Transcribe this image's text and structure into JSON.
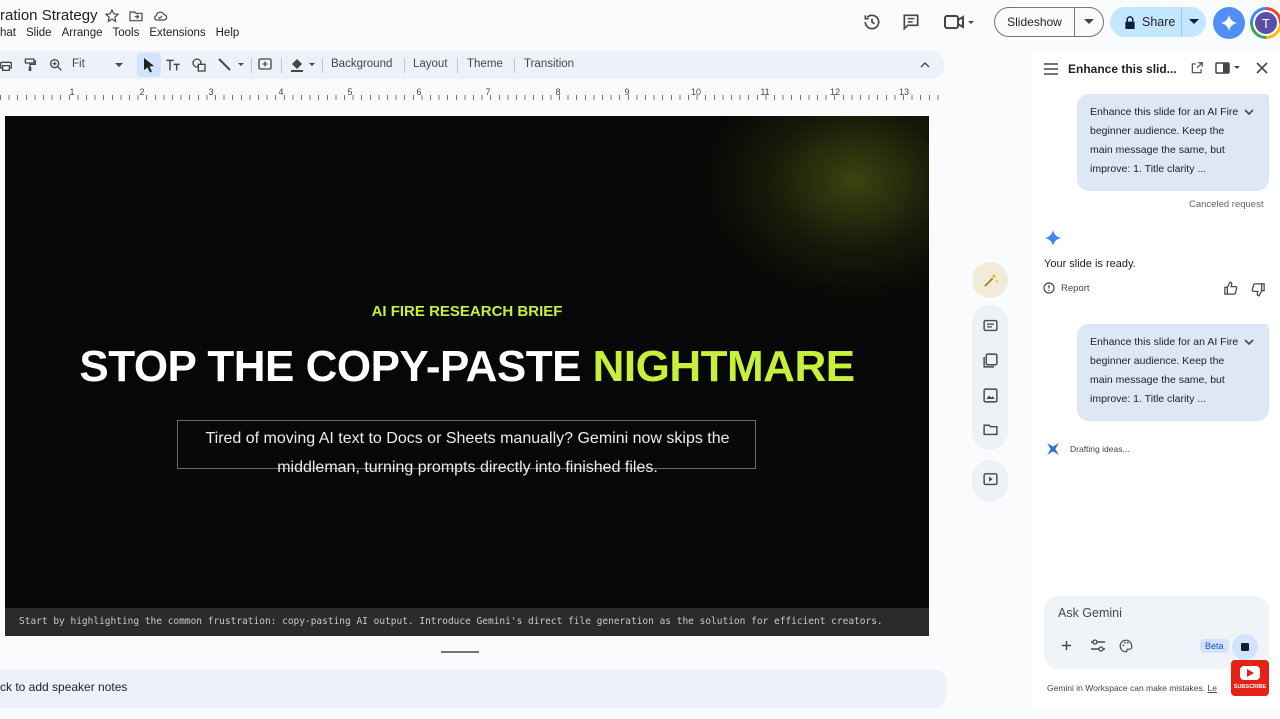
{
  "app": {
    "doc_title": "ration Strategy",
    "menu": [
      "hat",
      "Slide",
      "Arrange",
      "Tools",
      "Extensions",
      "Help"
    ],
    "slideshow_label": "Slideshow",
    "share_label": "Share",
    "avatar_initial": "T"
  },
  "toolbar": {
    "zoom_value": "Fit",
    "background_label": "Background",
    "layout_label": "Layout",
    "theme_label": "Theme",
    "transition_label": "Transition"
  },
  "ruler": {
    "numbers": [
      "1",
      "2",
      "3",
      "4",
      "5",
      "6",
      "7",
      "8",
      "9",
      "10",
      "11",
      "12",
      "13"
    ]
  },
  "slide": {
    "eyebrow": "AI FIRE RESEARCH BRIEF",
    "headline_main": "STOP THE COPY-PASTE ",
    "headline_accent": "NIGHTMARE",
    "subtitle": "Tired of moving AI text to Docs or Sheets manually? Gemini now skips the middleman, turning prompts directly into finished files.",
    "notes_text": "Start by highlighting the common frustration: copy-pasting AI output. Introduce Gemini's direct file generation as the solution for efficient creators.",
    "accent_color": "#c6f03a",
    "background_color": "#070707"
  },
  "speaker_notes": {
    "placeholder": "ck to add speaker notes"
  },
  "gemini_panel": {
    "title": "Enhance this slid...",
    "messages": [
      {
        "text": "Enhance this slide for an AI Fire beginner audience. Keep the main message the same, but improve: 1. Title clarity ...",
        "status": "Canceled request"
      },
      {
        "text": "Enhance this slide for an AI Fire beginner audience. Keep the main message the same, but improve: 1. Title clarity ..."
      }
    ],
    "response_text": "Your slide is ready.",
    "report_label": "Report",
    "drafting_label": "Drafting ideas...",
    "input_placeholder": "Ask Gemini",
    "beta_label": "Beta",
    "disclaimer": "Gemini in Workspace can make mistakes.",
    "disclaimer_link": "Le"
  },
  "overlay": {
    "subscribe_label": "SUBSCRIBE"
  }
}
